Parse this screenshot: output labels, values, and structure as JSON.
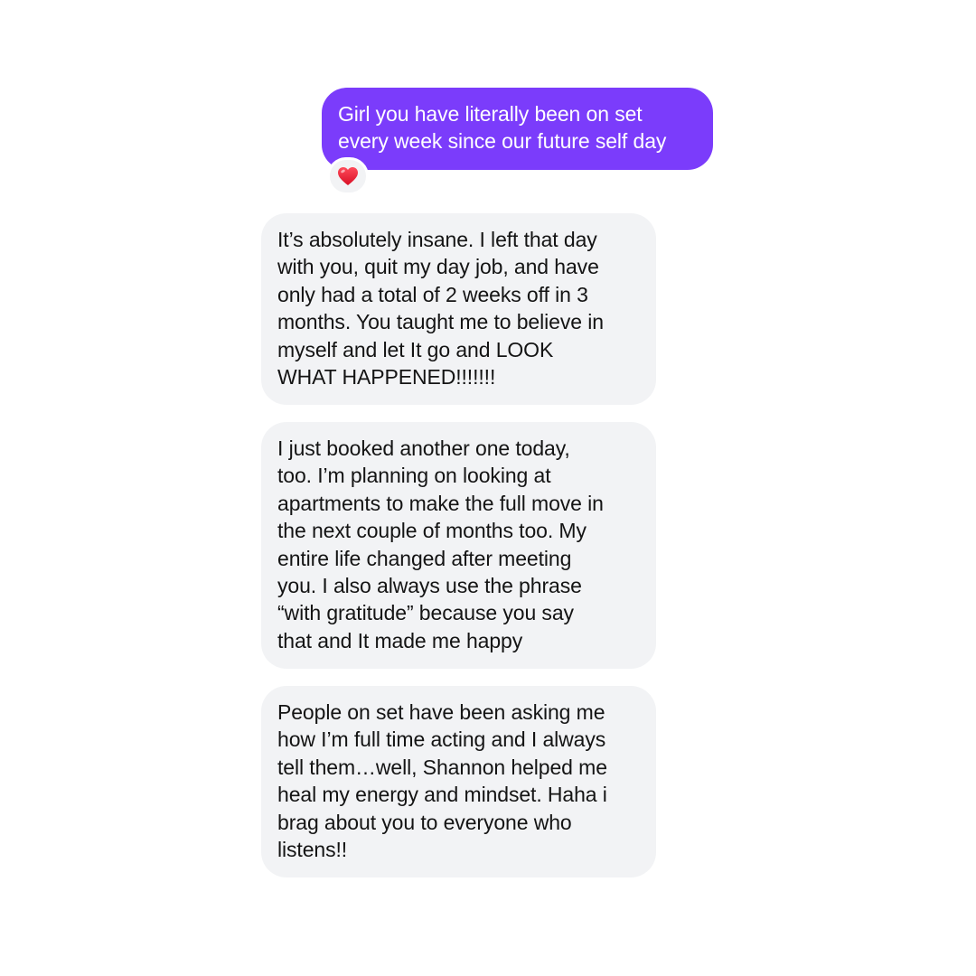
{
  "conversation": {
    "messages": [
      {
        "direction": "sent",
        "text": "Girl you have literally been on set\nevery week since our future self day",
        "reaction": "heart-reaction"
      },
      {
        "direction": "received",
        "text": "It’s absolutely insane. I left that day\nwith you, quit my day job, and have\nonly had a total of 2 weeks off in 3\nmonths. You taught me to believe in\nmyself and let It go and LOOK\nWHAT HAPPENED!!!!!!!"
      },
      {
        "direction": "received",
        "text": "I just booked another one today,\ntoo. I’m planning on looking at\napartments to make the full move in\nthe next couple of months too. My\nentire life changed after meeting\nyou. I also always use the phrase\n“with gratitude” because you say\nthat and It made me happy"
      },
      {
        "direction": "received",
        "text": "People on set have been asking me\nhow I’m full time acting and I always\ntell them…well, Shannon helped me\nheal my energy and mindset. Haha i\nbrag about you to everyone who\nlistens!!"
      }
    ]
  },
  "colors": {
    "sent_bubble": "#7b3cfb",
    "received_bubble": "#f2f3f5",
    "heart": "#e8112d"
  }
}
